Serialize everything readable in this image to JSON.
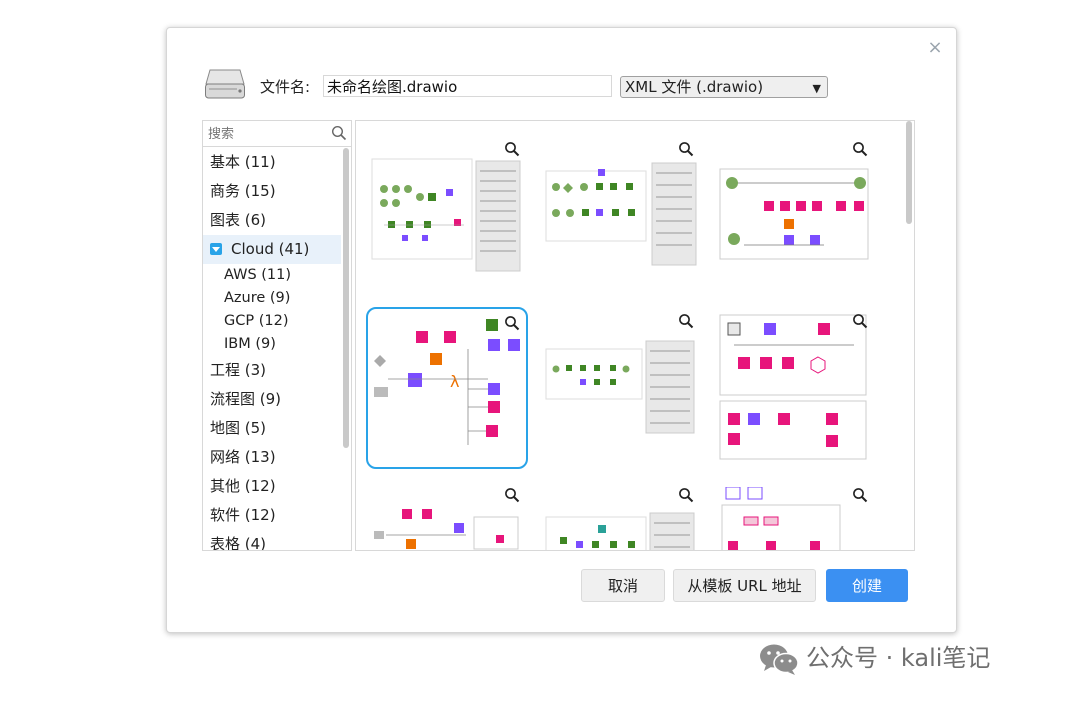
{
  "dialog": {
    "close_glyph": "×",
    "filename_label": "文件名:",
    "filename_value": "未命名绘图.drawio",
    "format_selected": "XML 文件 (.drawio)"
  },
  "search": {
    "placeholder": "搜索"
  },
  "categories": {
    "basic": "基本 (11)",
    "business": "商务 (15)",
    "charts": "图表 (6)",
    "cloud": "Cloud (41)",
    "aws": "AWS (11)",
    "azure": "Azure (9)",
    "gcp": "GCP (12)",
    "ibm": "IBM (9)",
    "engineering": "工程 (3)",
    "flowchart": "流程图 (9)",
    "maps": "地图 (5)",
    "network": "网络 (13)",
    "other": "其他 (12)",
    "software": "软件 (12)",
    "tables": "表格 (4)"
  },
  "buttons": {
    "cancel": "取消",
    "from_url": "从模板 URL 地址",
    "create": "创建"
  },
  "watermark": {
    "text": "公众号 · kali笔记"
  },
  "colors": {
    "accent": "#29a3e8",
    "create": "#3b90f2",
    "aws_pink": "#e7157b",
    "aws_purple": "#7b4dff",
    "aws_green": "#3f8624",
    "aws_orange": "#ed7100"
  },
  "icons": [
    "drive-icon",
    "close-icon",
    "search-icon",
    "zoom-icon",
    "chevron-down-icon",
    "wechat-icon"
  ]
}
